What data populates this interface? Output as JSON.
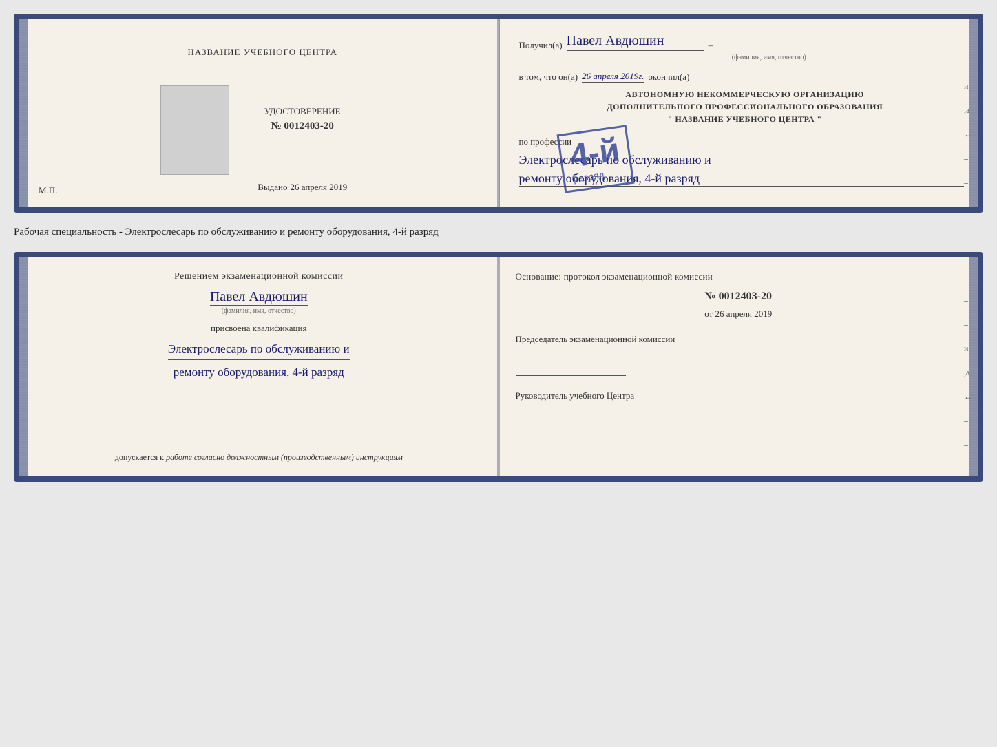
{
  "topDoc": {
    "left": {
      "centerTitle": "НАЗВАНИЕ УЧЕБНОГО ЦЕНТРА",
      "certLabel": "УДОСТОВЕРЕНИЕ",
      "certNumber": "№ 0012403-20",
      "issuedLabel": "Выдано",
      "issuedDate": "26 апреля 2019",
      "mpLabel": "М.П."
    },
    "right": {
      "recipientPrefix": "Получил(а)",
      "recipientName": "Павел Авдюшин",
      "recipientDash": "–",
      "fioLabel": "(фамилия, имя, отчество)",
      "vtomPrefix": "в том, что он(а)",
      "vtomDate": "26 апреля 2019г.",
      "okончил": "окончил(а)",
      "org1": "АВТОНОМНУЮ НЕКОММЕРЧЕСКУЮ ОРГАНИЗАЦИЮ",
      "org2": "ДОПОЛНИТЕЛЬНОГО ПРОФЕССИОНАЛЬНОГО ОБРАЗОВАНИЯ",
      "org3": "\" НАЗВАНИЕ УЧЕБНОГО ЦЕНТРА \"",
      "poLabel": "по профессии",
      "profession1": "Электрослесарь по обслуживанию и",
      "profession2": "ремонту оборудования, 4-й разряд",
      "gradeNumber": "4-й",
      "gradeText": "разряд",
      "spineChars": [
        "–",
        "–",
        "и",
        ",а",
        "←",
        "–",
        "–",
        "–"
      ]
    }
  },
  "specialtyLabel": "Рабочая специальность - Электрослесарь по обслуживанию и ремонту оборудования, 4-й разряд",
  "bottomDoc": {
    "left": {
      "commissionTitle": "Решением экзаменационной комиссии",
      "personName": "Павел Авдюшин",
      "fioLabel": "(фамилия, имя, отчество)",
      "prisvoena": "присвоена квалификация",
      "qual1": "Электрослесарь по обслуживанию и",
      "qual2": "ремонту оборудования, 4-й разряд",
      "допускается": "допускается к",
      "допускаетсяText": "работе согласно должностным (производственным) инструкциям"
    },
    "right": {
      "osnovaniye": "Основание: протокол экзаменационной комиссии",
      "protocolNumber": "№  0012403-20",
      "otLabel": "от 26 апреля 2019",
      "chairmanTitle": "Председатель экзаменационной комиссии",
      "directorTitle": "Руководитель учебного Центра",
      "spineChars": [
        "–",
        "–",
        "–",
        "и",
        ",а",
        "←",
        "–",
        "–",
        "–"
      ]
    }
  }
}
